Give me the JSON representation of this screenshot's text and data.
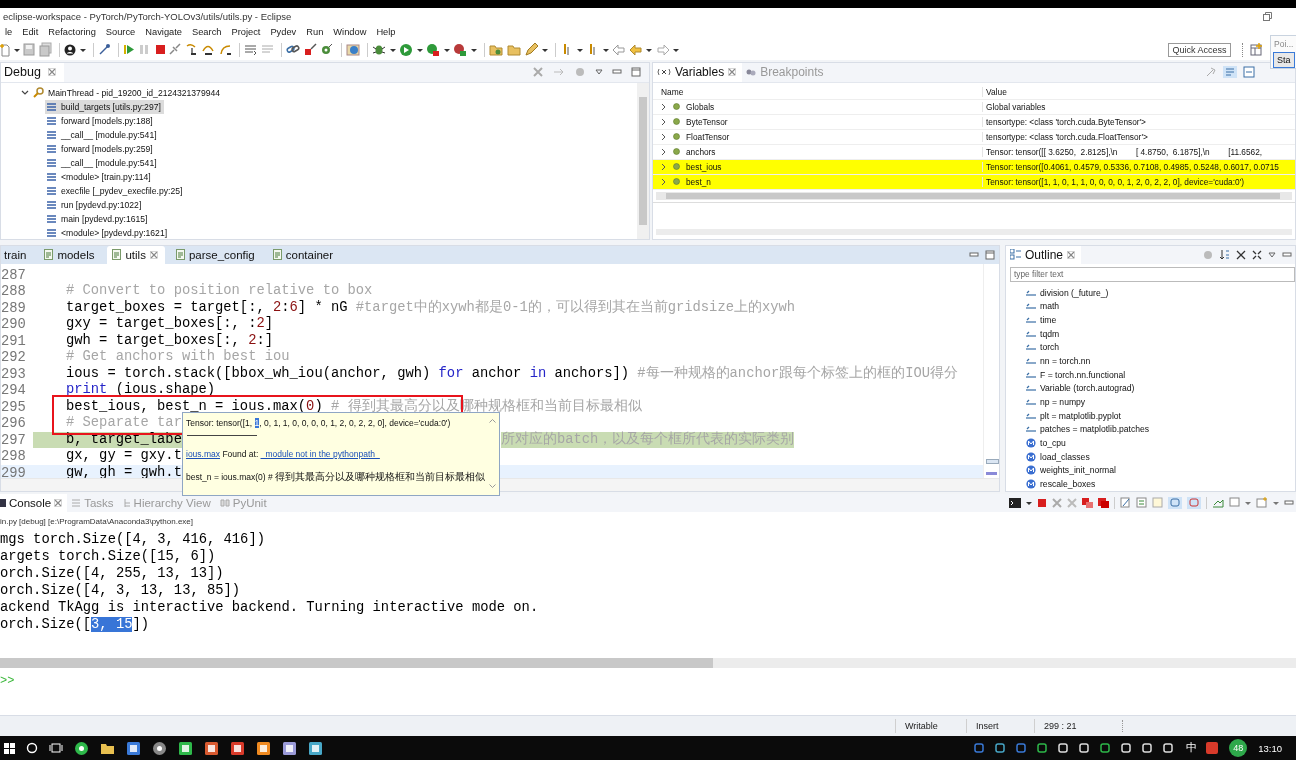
{
  "window": {
    "title": "eclipse-workspace - PyTorch/PyTorch-YOLOv3/utils/utils.py - Eclipse"
  },
  "menu": [
    "le",
    "Edit",
    "Refactoring",
    "Source",
    "Navigate",
    "Search",
    "Project",
    "Pydev",
    "Run",
    "Window",
    "Help"
  ],
  "quick_access": {
    "label": "Quick Access"
  },
  "popup": {
    "title": "Poi...",
    "button": "Sta"
  },
  "debug": {
    "tab": "Debug",
    "thread": {
      "label": "MainThread - pid_19200_id_2124321379944",
      "expanded": true,
      "frames": [
        {
          "label": "build_targets [utils.py:297]",
          "selected": true
        },
        {
          "label": "forward [models.py:188]",
          "selected": false
        },
        {
          "label": "__call__ [module.py:541]",
          "selected": false
        },
        {
          "label": "forward [models.py:259]",
          "selected": false
        },
        {
          "label": "__call__ [module.py:541]",
          "selected": false
        },
        {
          "label": "<module> [train.py:114]",
          "selected": false
        },
        {
          "label": "execfile [_pydev_execfile.py:25]",
          "selected": false
        },
        {
          "label": "run [pydevd.py:1022]",
          "selected": false
        },
        {
          "label": "main [pydevd.py:1615]",
          "selected": false
        },
        {
          "label": "<module> [pydevd.py:1621]",
          "selected": false
        }
      ]
    }
  },
  "variables": {
    "tabs": [
      {
        "label": "Variables",
        "selected": true
      },
      {
        "label": "Breakpoints",
        "selected": false
      }
    ],
    "columns": [
      "Name",
      "Value"
    ],
    "rows": [
      {
        "name": "Globals",
        "value": "Global variables",
        "changed": false
      },
      {
        "name": "ByteTensor",
        "value": "tensortype: <class 'torch.cuda.ByteTensor'>",
        "changed": false
      },
      {
        "name": "FloatTensor",
        "value": "tensortype: <class 'torch.cuda.FloatTensor'>",
        "changed": false
      },
      {
        "name": "anchors",
        "value": "Tensor: tensor([[ 3.6250,  2.8125],\\n        [ 4.8750,  6.1875],\\n        [11.6562,",
        "changed": false
      },
      {
        "name": "best_ious",
        "value": "Tensor: tensor([0.4061, 0.4579, 0.5336, 0.7108, 0.4985, 0.5248, 0.6017, 0.0715",
        "changed": true
      },
      {
        "name": "best_n",
        "value": "Tensor: tensor([1, 1, 0, 1, 1, 0, 0, 0, 0, 1, 2, 0, 2, 2, 0], device='cuda:0')",
        "changed": true
      }
    ]
  },
  "editor": {
    "tabs": [
      {
        "label": "train",
        "selected": false
      },
      {
        "label": "models",
        "selected": false
      },
      {
        "label": "utils",
        "selected": true
      },
      {
        "label": "parse_config",
        "selected": false
      },
      {
        "label": "container",
        "selected": false
      }
    ],
    "lines": [
      {
        "number": "287",
        "executing": false,
        "cursor": false
      },
      {
        "number": "288",
        "executing": false,
        "cursor": false,
        "parts": [
          {
            "kind": "comment",
            "text": "# Convert to position relative to box"
          }
        ]
      },
      {
        "number": "289",
        "executing": false,
        "cursor": false,
        "parts": [
          {
            "kind": "code",
            "text": "target_boxes = target[:, "
          },
          {
            "kind": "number",
            "text": "2"
          },
          {
            "kind": "code",
            "text": ":"
          },
          {
            "kind": "number",
            "text": "6"
          },
          {
            "kind": "code",
            "text": "] * nG "
          },
          {
            "kind": "comment",
            "text": "#target中的xywh都是0-1的，可以得到其在当前gridsize上的xywh"
          }
        ]
      },
      {
        "number": "290",
        "executing": false,
        "cursor": false,
        "parts": [
          {
            "kind": "code",
            "text": "gxy = target_boxes[:, :"
          },
          {
            "kind": "number",
            "text": "2"
          },
          {
            "kind": "code",
            "text": "]"
          }
        ]
      },
      {
        "number": "291",
        "executing": false,
        "cursor": false,
        "parts": [
          {
            "kind": "code",
            "text": "gwh = target_boxes[:, "
          },
          {
            "kind": "number",
            "text": "2"
          },
          {
            "kind": "code",
            "text": ":]"
          }
        ]
      },
      {
        "number": "292",
        "executing": false,
        "cursor": false,
        "parts": [
          {
            "kind": "comment",
            "text": "# Get anchors with best iou"
          }
        ]
      },
      {
        "number": "293",
        "executing": false,
        "cursor": false,
        "parts": [
          {
            "kind": "code",
            "text": "ious = torch.stack([bbox_wh_iou(anchor, gwh) "
          },
          {
            "kind": "keyword",
            "text": "for"
          },
          {
            "kind": "code",
            "text": " anchor "
          },
          {
            "kind": "keyword",
            "text": "in"
          },
          {
            "kind": "code",
            "text": " anchors]) "
          },
          {
            "kind": "comment",
            "text": "#每一种规格的anchor跟每个标签上的框的IOU得分"
          }
        ]
      },
      {
        "number": "294",
        "executing": false,
        "cursor": false,
        "parts": [
          {
            "kind": "keyword",
            "text": "print"
          },
          {
            "kind": "code",
            "text": " (ious.shape)"
          }
        ]
      },
      {
        "number": "295",
        "executing": false,
        "cursor": false,
        "parts": [
          {
            "kind": "code",
            "text": "best_ious, best_n = ious.max("
          },
          {
            "kind": "number",
            "text": "0"
          },
          {
            "kind": "code",
            "text": ") "
          },
          {
            "kind": "comment",
            "text": "# 得到其最高分以及哪种规格框和当前目标最相似"
          }
        ]
      },
      {
        "number": "296",
        "executing": false,
        "cursor": false,
        "parts": [
          {
            "kind": "comment",
            "text": "# Separate tar"
          }
        ]
      },
      {
        "number": "297",
        "executing": true,
        "cursor": false,
        "parts": [
          {
            "kind": "code",
            "text": "b, target_labe"
          }
        ],
        "tail": "所对应的batch，以及每个框所代表的实际类别"
      },
      {
        "number": "298",
        "executing": false,
        "cursor": false,
        "parts": [
          {
            "kind": "code",
            "text": "gx, gy = gxy.t"
          }
        ]
      },
      {
        "number": "299",
        "executing": false,
        "cursor": true,
        "parts": [
          {
            "kind": "code",
            "text": "gw, gh = gwh.t"
          }
        ]
      }
    ],
    "hover": {
      "before": "Tensor: tensor([1, ",
      "selection": "1",
      "after": ", 0, 1, 1, 0, 0, 0, 0, 1, 2, 0, 2, 2, 0], device='cuda:0')",
      "link": "ious.max",
      "found_label": "Found at:",
      "location": "_module not in the pythonpath_",
      "source": "best_n = ious.max(0) # 得到其最高分以及哪种规格框和当前目标最相似"
    }
  },
  "outline": {
    "title": "Outline",
    "filter": {
      "placeholder": "type filter text"
    },
    "items": [
      {
        "label": "division (_future_)",
        "kind": "import"
      },
      {
        "label": "math",
        "kind": "import"
      },
      {
        "label": "time",
        "kind": "import"
      },
      {
        "label": "tqdm",
        "kind": "import"
      },
      {
        "label": "torch",
        "kind": "import"
      },
      {
        "label": "nn = torch.nn",
        "kind": "import"
      },
      {
        "label": "F = torch.nn.functional",
        "kind": "import"
      },
      {
        "label": "Variable (torch.autograd)",
        "kind": "import"
      },
      {
        "label": "np = numpy",
        "kind": "import"
      },
      {
        "label": "plt = matplotlib.pyplot",
        "kind": "import"
      },
      {
        "label": "patches = matplotlib.patches",
        "kind": "import"
      },
      {
        "label": "to_cpu",
        "kind": "function"
      },
      {
        "label": "load_classes",
        "kind": "function"
      },
      {
        "label": "weights_init_normal",
        "kind": "function"
      },
      {
        "label": "rescale_boxes",
        "kind": "function"
      }
    ]
  },
  "console": {
    "tabs": [
      {
        "label": "Console",
        "selected": true
      },
      {
        "label": "Tasks",
        "selected": false
      },
      {
        "label": "Hierarchy View",
        "selected": false
      },
      {
        "label": "PyUnit",
        "selected": false
      }
    ],
    "process": "in.py [debug] [e:\\ProgramData\\Anaconda3\\python.exe]",
    "lines": [
      {
        "text": "mgs torch.Size([4, 3, 416, 416])"
      },
      {
        "text": "argets torch.Size([15, 6])"
      },
      {
        "text": "orch.Size([4, 255, 13, 13])"
      },
      {
        "text": "orch.Size([4, 3, 13, 13, 85])"
      },
      {
        "text": "ackend TkAgg is interactive backend. Turning interactive mode on."
      },
      {
        "text": "orch.Size([",
        "selection": "3, 15",
        "after": "])"
      }
    ],
    "prompt": ">>"
  },
  "status_bar": [
    "Writable",
    "Insert",
    "299 : 21"
  ],
  "taskbar": {
    "input_method": "中",
    "badge": "48",
    "clock": "13:10"
  }
}
